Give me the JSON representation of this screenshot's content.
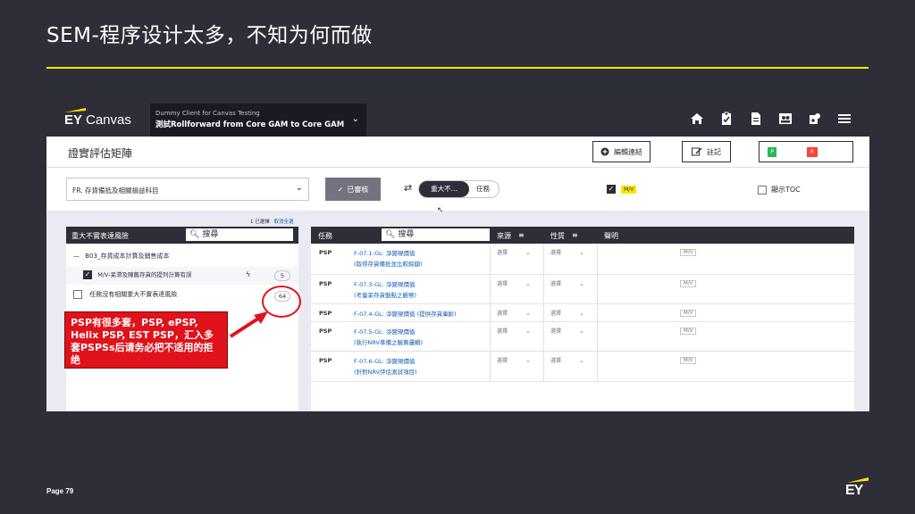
{
  "slide": {
    "title": "SEM-程序设计太多，不知为何而做",
    "page": "Page 79",
    "logo_text": "EY",
    "accent": "#ffe600"
  },
  "app": {
    "brand_ey": "EY",
    "brand_name": "Canvas",
    "client_sub": "Dummy Client for Canvas Testing",
    "client_main": "測試Rollforward from Core GAM to Core GAM",
    "top_icons": [
      "home-icon",
      "clipboard-check-icon",
      "document-icon",
      "people-icon",
      "puzzle-icon",
      "menu-icon"
    ],
    "page_heading": "證實評估矩陣",
    "edit_link_btn": "編輯連結",
    "note_btn": "註記",
    "status_p": "P",
    "status_r": "R",
    "account_select": "FR. 存貨備抵及相關損益科目",
    "reviewed_btn": "已審核",
    "toggle_on": "重大不...",
    "toggle_off": "任務",
    "mv_label": "M/V",
    "show_toc": "顯示TOC",
    "selection_count": "1 已選擇",
    "clear_all": "取消全選"
  },
  "left_panel": {
    "header": "重大不實表達風險",
    "search_placeholder": "搜尋",
    "group_label": "B03_存貨成本計算及銷售成本",
    "item1_label": "M/V-呆滯及陳舊存貨的提列計算有誤",
    "item1_count": "5",
    "item2_label": "任務沒有相關重大不實表達風險",
    "item2_count": "64"
  },
  "right_panel": {
    "headers": {
      "task": "任務",
      "search": "搜尋",
      "source": "來源",
      "nature": "性質",
      "statement": "聲明"
    },
    "rows": [
      {
        "type": "PSP",
        "line1": "F-07.1-GL: 淨變現價值",
        "line2": "(取得存貨備抵並比較餘額)",
        "source": "選擇",
        "nature": "選擇",
        "mv": "M/V"
      },
      {
        "type": "PSP",
        "line1": "F-07.3-GL: 淨變現價值",
        "line2": "(考量呆存貨盤點之觀察)",
        "source": "選擇",
        "nature": "選擇",
        "mv": "M/V"
      },
      {
        "type": "PSP",
        "line1": "F-07.4-GL: 淨變現價值 (提供存貨庫齡)",
        "line2": "",
        "source": "選擇",
        "nature": "選擇",
        "mv": "M/V"
      },
      {
        "type": "PSP",
        "line1": "F-07.5-GL: 淨變現價值",
        "line2": "(執行NRV準備之驗算邏輯)",
        "source": "選擇",
        "nature": "選擇",
        "mv": "M/V"
      },
      {
        "type": "PSP",
        "line1": "F-07.6-GL: 淨變現價值",
        "line2": "(針對NRV評估測試項目)",
        "source": "選擇",
        "nature": "選擇",
        "mv": "M/V"
      }
    ]
  },
  "callout": {
    "text": "PSP有很多套，PSP, ePSP, Helix PSP, EST PSP，汇入多套PSPSs后请务必把不适用的拒绝"
  }
}
